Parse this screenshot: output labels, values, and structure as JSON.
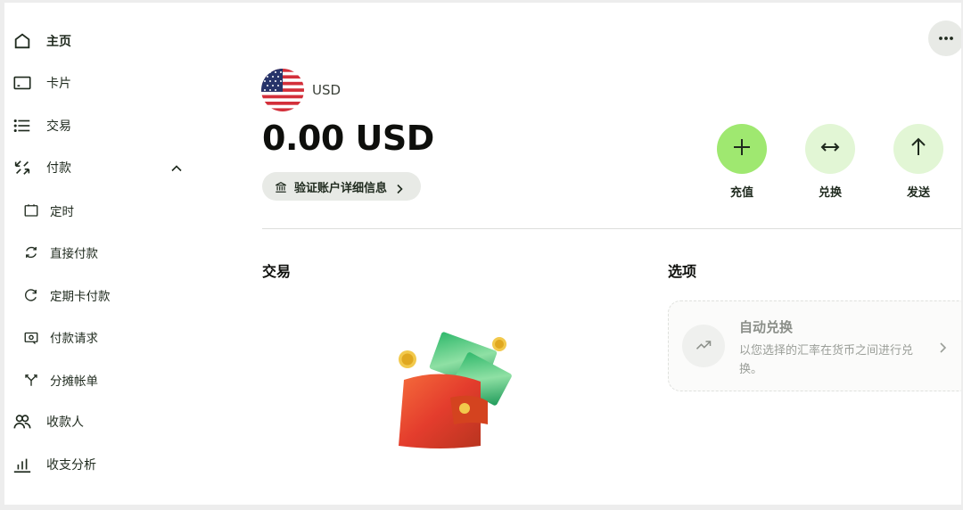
{
  "sidebar": {
    "items": [
      {
        "label": "主页",
        "icon": "home-icon",
        "active": true
      },
      {
        "label": "卡片",
        "icon": "card-icon"
      },
      {
        "label": "交易",
        "icon": "list-icon"
      },
      {
        "label": "付款",
        "icon": "payments-icon",
        "expanded": true
      },
      {
        "label": "定时",
        "icon": "calendar-icon",
        "sub": true
      },
      {
        "label": "直接付款",
        "icon": "refresh-icon",
        "sub": true
      },
      {
        "label": "定期卡付款",
        "icon": "recurring-icon",
        "sub": true
      },
      {
        "label": "付款请求",
        "icon": "request-icon",
        "sub": true
      },
      {
        "label": "分摊帐单",
        "icon": "split-icon",
        "sub": true
      },
      {
        "label": "收款人",
        "icon": "recipients-icon"
      },
      {
        "label": "收支分析",
        "icon": "bar-chart-icon"
      }
    ]
  },
  "account": {
    "currency_code": "USD",
    "balance": "0.00 USD",
    "verify_label": "验证账户详细信息"
  },
  "actions": [
    {
      "label": "充值",
      "icon": "plus-icon",
      "color": "#9fe870"
    },
    {
      "label": "兑换",
      "icon": "swap-icon",
      "color": "#e2f6d5"
    },
    {
      "label": "发送",
      "icon": "arrow-up-icon",
      "color": "#e2f6d5"
    }
  ],
  "transactions": {
    "title": "交易"
  },
  "options": {
    "title": "选项",
    "card": {
      "title": "自动兑换",
      "description": "以您选择的汇率在货币之间进行兑换。",
      "icon": "trend-up-icon"
    }
  },
  "colors": {
    "accent": "#9fe870",
    "accent_soft": "#e2f6d5",
    "text": "#1f2a1e",
    "pill": "#e8eae6"
  }
}
